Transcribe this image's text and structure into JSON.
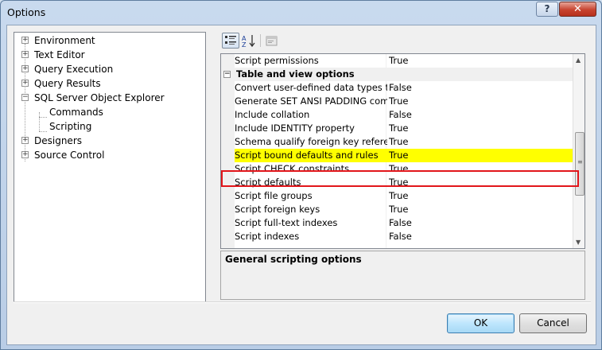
{
  "window": {
    "title": "Options",
    "help_glyph": "?",
    "close_glyph": "✕"
  },
  "tree": {
    "items": [
      {
        "label": "Environment",
        "expander": "+"
      },
      {
        "label": "Text Editor",
        "expander": "+"
      },
      {
        "label": "Query Execution",
        "expander": "+"
      },
      {
        "label": "Query Results",
        "expander": "+"
      },
      {
        "label": "SQL Server Object Explorer",
        "expander": "−"
      },
      {
        "label": "Commands"
      },
      {
        "label": "Scripting"
      },
      {
        "label": "Designers",
        "expander": "+"
      },
      {
        "label": "Source Control",
        "expander": "+"
      }
    ]
  },
  "toolbar": {
    "categorized_icon": "categorized-icon",
    "alphabetical_icon": "alphabetical-icon",
    "property_pages_icon": "property-pages-icon"
  },
  "grid": {
    "rows": [
      {
        "name": "Script permissions",
        "value": "True"
      },
      {
        "category": "Table and view options",
        "expander": "−"
      },
      {
        "name": "Convert user-defined data types to bas",
        "value": "False"
      },
      {
        "name": "Generate SET ANSI PADDING command",
        "value": "True"
      },
      {
        "name": "Include collation",
        "value": "False"
      },
      {
        "name": "Include IDENTITY property",
        "value": "True"
      },
      {
        "name": "Schema qualify foreign key references",
        "value": "True"
      },
      {
        "name": "Script bound defaults and rules",
        "value": "True",
        "selected": true
      },
      {
        "name": "Script CHECK constraints",
        "value": "True"
      },
      {
        "name": "Script defaults",
        "value": "True"
      },
      {
        "name": "Script file groups",
        "value": "True"
      },
      {
        "name": "Script foreign keys",
        "value": "True"
      },
      {
        "name": "Script full-text indexes",
        "value": "False"
      },
      {
        "name": "Script indexes",
        "value": "False"
      }
    ],
    "highlight_color": "#ffff00",
    "annotation_color": "#e2161b"
  },
  "description": {
    "title": "General scripting options"
  },
  "buttons": {
    "ok": "OK",
    "cancel": "Cancel"
  }
}
